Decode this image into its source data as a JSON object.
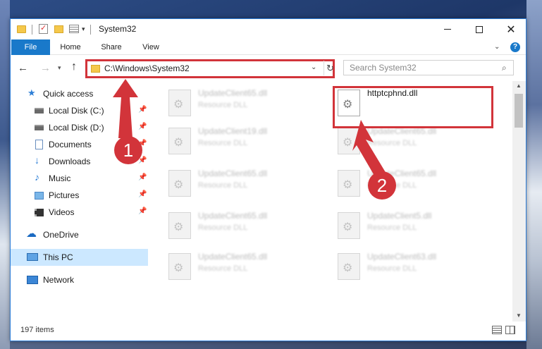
{
  "window": {
    "title": "System32",
    "minimize_glyph": "",
    "maximize_glyph": "",
    "close_glyph": "✕"
  },
  "ribbon": {
    "tabs": [
      "File",
      "Home",
      "Share",
      "View"
    ],
    "help_glyph": "?"
  },
  "nav": {
    "address": "C:\\Windows\\System32",
    "search_placeholder": "Search System32"
  },
  "sidebar": {
    "items": [
      {
        "label": "Quick access",
        "icon": "star-icon"
      },
      {
        "label": "Local Disk (C:)",
        "icon": "drive-icon",
        "pinned": true
      },
      {
        "label": "Local Disk (D:)",
        "icon": "drive-icon",
        "pinned": true
      },
      {
        "label": "Documents",
        "icon": "documents-icon",
        "pinned": true
      },
      {
        "label": "Downloads",
        "icon": "downloads-icon",
        "pinned": true
      },
      {
        "label": "Music",
        "icon": "music-icon",
        "pinned": true
      },
      {
        "label": "Pictures",
        "icon": "pictures-icon",
        "pinned": true
      },
      {
        "label": "Videos",
        "icon": "videos-icon",
        "pinned": true
      },
      {
        "label": "OneDrive",
        "icon": "onedrive-icon"
      },
      {
        "label": "This PC",
        "icon": "pc-icon",
        "selected": true
      },
      {
        "label": "Network",
        "icon": "network-icon"
      }
    ]
  },
  "files": [
    {
      "name": "UpdateClient65.dll",
      "type": "Resource DLL"
    },
    {
      "name": "httptcphnd.dll",
      "type": "",
      "highlighted": true
    },
    {
      "name": "UpdateClient19.dll",
      "type": "Resource DLL"
    },
    {
      "name": "UpdateClient65.dll",
      "type": "Resource DLL"
    },
    {
      "name": "UpdateClient65.dll",
      "type": "Resource DLL"
    },
    {
      "name": "UpdateClient65.dll",
      "type": "Resource DLL"
    },
    {
      "name": "UpdateClient65.dll",
      "type": "Resource DLL"
    },
    {
      "name": "UpdateClient5.dll",
      "type": "Resource DLL"
    },
    {
      "name": "UpdateClient65.dll",
      "type": "Resource DLL"
    },
    {
      "name": "UpdateClient63.dll",
      "type": "Resource DLL"
    }
  ],
  "status": {
    "item_count": "197 items"
  },
  "annotations": {
    "step1": "1",
    "step2": "2",
    "highlight_color": "#d2343a"
  }
}
